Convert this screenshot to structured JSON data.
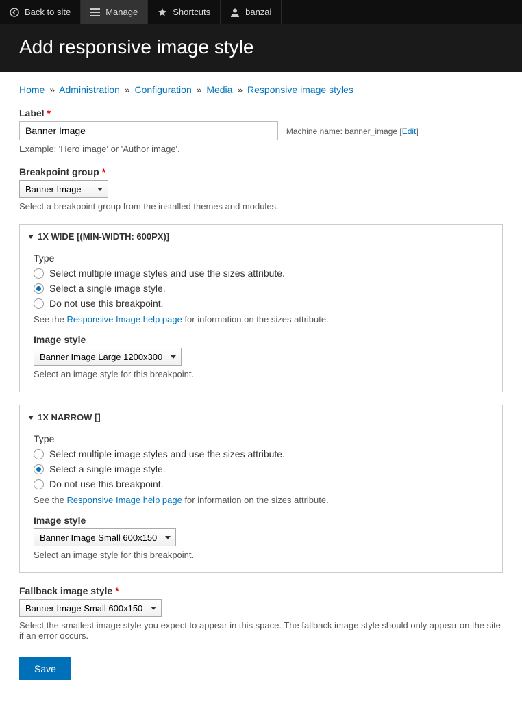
{
  "toolbar": {
    "back": "Back to site",
    "manage": "Manage",
    "shortcuts": "Shortcuts",
    "user": "banzai"
  },
  "page_title": "Add responsive image style",
  "breadcrumb": {
    "home": "Home",
    "admin": "Administration",
    "config": "Configuration",
    "media": "Media",
    "current": "Responsive image styles"
  },
  "label_field": {
    "label": "Label",
    "value": "Banner Image",
    "machine_name_label": "Machine name:",
    "machine_name_value": "banner_image",
    "edit": "Edit",
    "example": "Example: 'Hero image' or 'Author image'."
  },
  "breakpoint_group": {
    "label": "Breakpoint group",
    "value": "Banner Image",
    "description": "Select a breakpoint group from the installed themes and modules."
  },
  "panels": [
    {
      "title": "1X Wide [(min-width: 600px)]",
      "type_label": "Type",
      "options": {
        "multiple": "Select multiple image styles and use the sizes attribute.",
        "single": "Select a single image style.",
        "none": "Do not use this breakpoint."
      },
      "help_pre": "See the ",
      "help_link": "Responsive Image help page",
      "help_post": " for information on the sizes attribute.",
      "style_label": "Image style",
      "style_value": "Banner Image Large 1200x300",
      "style_desc": "Select an image style for this breakpoint."
    },
    {
      "title": "1X Narrow []",
      "type_label": "Type",
      "options": {
        "multiple": "Select multiple image styles and use the sizes attribute.",
        "single": "Select a single image style.",
        "none": "Do not use this breakpoint."
      },
      "help_pre": "See the ",
      "help_link": "Responsive Image help page",
      "help_post": " for information on the sizes attribute.",
      "style_label": "Image style",
      "style_value": "Banner Image Small 600x150",
      "style_desc": "Select an image style for this breakpoint."
    }
  ],
  "fallback": {
    "label": "Fallback image style",
    "value": "Banner Image Small 600x150",
    "description": "Select the smallest image style you expect to appear in this space. The fallback image style should only appear on the site if an error occurs."
  },
  "save": "Save"
}
